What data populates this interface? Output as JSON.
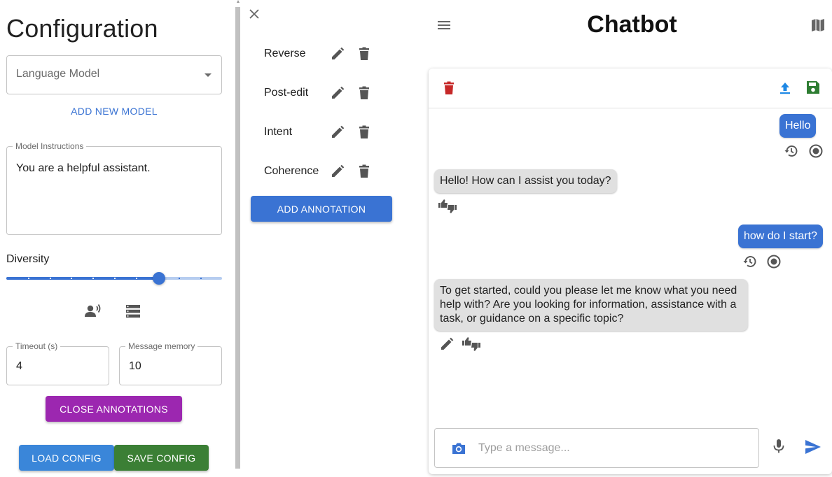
{
  "config": {
    "title": "Configuration",
    "model_select_label": "Language Model",
    "add_model_label": "ADD NEW MODEL",
    "instructions_legend": "Model Instructions",
    "instructions_value": "You are a helpful assistant.",
    "diversity_label": "Diversity",
    "diversity_value": 0.7,
    "timeout_legend": "Timeout (s)",
    "timeout_value": "4",
    "memory_legend": "Message memory",
    "memory_value": "10",
    "close_annotations_label": "CLOSE ANNOTATIONS",
    "load_config_label": "LOAD CONFIG",
    "save_config_label": "SAVE CONFIG"
  },
  "annotations": {
    "items": [
      {
        "label": "Reverse"
      },
      {
        "label": "Post-edit"
      },
      {
        "label": "Intent"
      },
      {
        "label": "Coherence"
      }
    ],
    "add_label": "ADD ANNOTATION"
  },
  "chat": {
    "title": "Chatbot",
    "messages": [
      {
        "role": "user",
        "text": "Hello"
      },
      {
        "role": "bot",
        "text": "Hello! How can I assist you today?"
      },
      {
        "role": "user",
        "text": "how do I start?"
      },
      {
        "role": "bot",
        "text": "To get started, could you please let me know what you need help with? Are you looking for information, assistance with a task, or guidance on a specific topic?"
      }
    ],
    "input_placeholder": "Type a message..."
  },
  "colors": {
    "primary_blue": "#3a73d3",
    "purple": "#9c27b0",
    "green": "#3b7f35",
    "red": "#c62828",
    "bot_bubble": "#e0e0e0"
  },
  "icons": [
    "close-icon",
    "edit-icon",
    "delete-icon",
    "menu-icon",
    "map-icon",
    "upload-icon",
    "save-icon",
    "history-icon",
    "record-icon",
    "thumbs-icon",
    "camera-icon",
    "mic-icon",
    "send-icon",
    "voice-icon",
    "storage-icon"
  ]
}
